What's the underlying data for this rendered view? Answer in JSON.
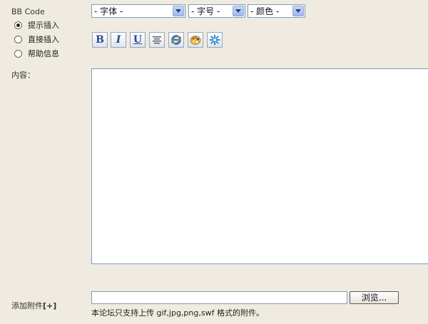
{
  "bbcode": {
    "label": "BB Code",
    "modes": [
      {
        "label": "提示插入",
        "selected": true
      },
      {
        "label": "直接插入",
        "selected": false
      },
      {
        "label": "帮助信息",
        "selected": false
      }
    ]
  },
  "selects": {
    "font": "- 字体 -",
    "size": "- 字号 -",
    "color": "- 颜色 -"
  },
  "toolbar": {
    "bold": "B",
    "italic": "I",
    "underline": "U",
    "icons": [
      "bold-icon",
      "italic-icon",
      "underline-icon",
      "align-center-icon",
      "internet-explorer-icon",
      "palette-icon",
      "sparkle-icon"
    ]
  },
  "content": {
    "label": "内容：",
    "value": ""
  },
  "attachment": {
    "label": "添加附件",
    "toggle": "[+]",
    "browse_label": "浏览...",
    "note": "本论坛只支持上传  gif,jpg,png,swf 格式的附件。"
  }
}
